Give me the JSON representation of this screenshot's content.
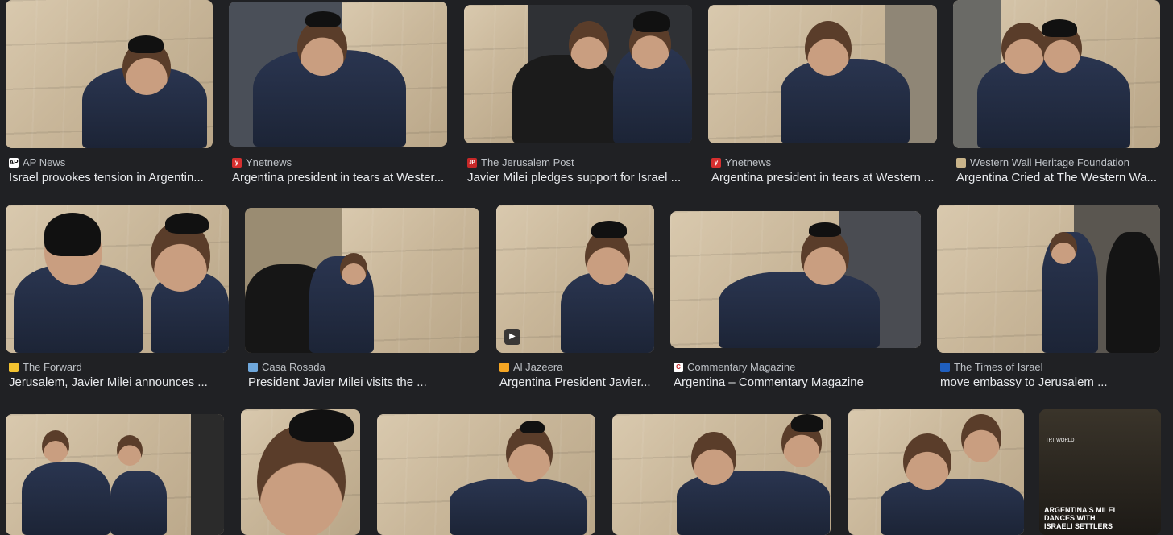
{
  "results": [
    {
      "source": "AP News",
      "favicon": "AP",
      "favicon_color": "#ffffff",
      "favicon_text": "#000000",
      "title": "Israel provokes tension in Argentin..."
    },
    {
      "source": "Ynetnews",
      "favicon": "y",
      "favicon_color": "#d62f2f",
      "favicon_text": "#ffffff",
      "title": "Argentina president in tears at Wester..."
    },
    {
      "source": "The Jerusalem Post",
      "favicon": "JP",
      "favicon_color": "#c62828",
      "favicon_text": "#ffffff",
      "title": "Javier Milei pledges support for Israel ..."
    },
    {
      "source": "Ynetnews",
      "favicon": "y",
      "favicon_color": "#d62f2f",
      "favicon_text": "#ffffff",
      "title": "Argentina president in tears at Western ..."
    },
    {
      "source": "Western Wall Heritage Foundation",
      "favicon": "",
      "favicon_color": "#c9b48a",
      "favicon_text": "#ffffff",
      "title": "Argentina Cried at The Western Wa..."
    },
    {
      "source": "The Forward",
      "favicon": "",
      "favicon_color": "#f2c230",
      "favicon_text": "#000000",
      "title": "Jerusalem, Javier Milei announces ..."
    },
    {
      "source": "Casa Rosada",
      "favicon": "",
      "favicon_color": "#6fa8dc",
      "favicon_text": "#ffffff",
      "title": "President Javier Milei visits the ..."
    },
    {
      "source": "Al Jazeera",
      "favicon": "",
      "favicon_color": "#f5a623",
      "favicon_text": "#ffffff",
      "title": "Argentina President Javier..."
    },
    {
      "source": "Commentary Magazine",
      "favicon": "C",
      "favicon_color": "#ffffff",
      "favicon_text": "#c62828",
      "title": "Argentina – Commentary Magazine"
    },
    {
      "source": "The Times of Israel",
      "favicon": "",
      "favicon_color": "#1f5fbf",
      "favicon_text": "#ffffff",
      "title": "move embassy to Jerusalem ..."
    }
  ],
  "video_overlay": {
    "channel": "TRT WORLD",
    "headline": "ARGENTINA'S MILEI DANCES WITH ISRAELI SETTLERS"
  },
  "play_icon": "play-icon"
}
